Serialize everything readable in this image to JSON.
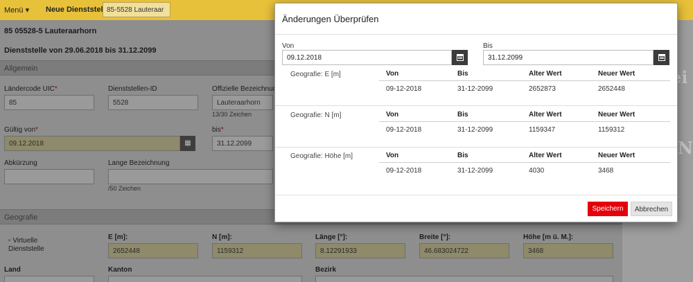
{
  "topbar": {
    "menu_label": "Menü ▾",
    "new_station_label": "Neue Dienststelle",
    "station_value": "85-5528 Lauteraar"
  },
  "form": {
    "title": "85 05528-5 Lauteraarhorn",
    "subtitle": "Dienststelle von 29.06.2018 bis 31.12.2099",
    "section_general": "Allgemein",
    "uic_label": "Ländercode UIC",
    "uic_value": "85",
    "id_label": "Dienststellen-ID",
    "id_value": "5528",
    "official_label": "Offizielle Bezeichnung",
    "official_value": "Lauteraarhorn",
    "official_hint": "13/30 Zeichen",
    "valid_from_label": "Gültig von",
    "valid_from_value": "09.12.2018",
    "valid_to_label": "bis",
    "valid_to_value": "31.12.2099",
    "abbr_label": "Abkürzung",
    "long_label": "Lange Bezeichnung",
    "long_hint": "/50 Zeichen",
    "section_geo": "Geografie",
    "virtual_label": "Virtuelle Dienststelle",
    "e_label": "E [m]:",
    "e_value": "2652448",
    "n_label": "N [m]:",
    "n_value": "1159312",
    "lon_label": "Länge [°]:",
    "lon_value": "8.12291933",
    "lat_label": "Breite [°]:",
    "lat_value": "46.683024722",
    "height_label": "Höhe [m ü. M.]:",
    "height_value": "3468",
    "land_label": "Land",
    "kanton_label": "Kanton",
    "bezirk_label": "Bezirk",
    "required_mark": "*"
  },
  "modal": {
    "title": "Änderungen Überprüfen",
    "from_label": "Von",
    "from_value": "09.12.2018",
    "to_label": "Bis",
    "to_value": "31.12.2099",
    "columns": [
      "Von",
      "Bis",
      "Alter Wert",
      "Neuer Wert"
    ],
    "groups": [
      {
        "name": "Geografie: E [m]",
        "von": "09-12-2018",
        "bis": "31-12-2099",
        "alt": "2652873",
        "neu": "2652448"
      },
      {
        "name": "Geografie: N [m]",
        "von": "09-12-2018",
        "bis": "31-12-2099",
        "alt": "1159347",
        "neu": "1159312"
      },
      {
        "name": "Geografie: Höhe [m]",
        "von": "09-12-2018",
        "bis": "31-12-2099",
        "alt": "4030",
        "neu": "3468"
      }
    ],
    "save_label": "Speichern",
    "cancel_label": "Abbrechen"
  },
  "colors": {
    "topbar": "#e8c13a",
    "save_button": "#e3000b"
  }
}
